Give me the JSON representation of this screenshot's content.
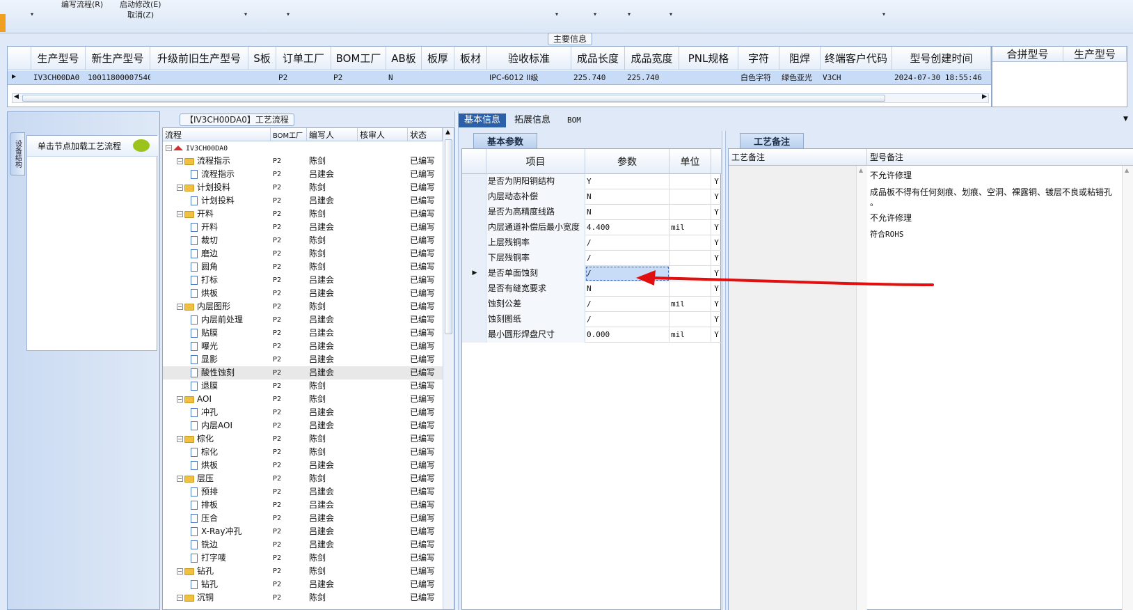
{
  "toolbar": {
    "items": [
      "编写流程(R)",
      "启动修改(E)",
      "取消(Z)"
    ]
  },
  "main_info": {
    "section_title": "主要信息",
    "columns": [
      "生产型号",
      "新生产型号",
      "升级前旧生产型号",
      "S板",
      "订单工厂",
      "BOM工厂",
      "AB板",
      "板厚",
      "板材",
      "验收标准",
      "成品长度",
      "成品宽度",
      "PNL规格",
      "字符",
      "阻焊",
      "终端客户代码",
      "型号创建时间"
    ],
    "row": [
      "IV3CH00DA0",
      "10011800007540",
      "",
      "",
      "P2",
      "P2",
      "N",
      "",
      "",
      "IPC-6012 II级",
      "225.740",
      "225.740",
      "",
      "白色字符",
      "绿色亚光",
      "V3CH",
      "2024-07-30 18:55:46"
    ],
    "merge_columns": [
      "合拼型号",
      "生产型号"
    ]
  },
  "nav": {
    "vertical_tab": "设备结构",
    "card_title": "单击节点加载工艺流程"
  },
  "tree": {
    "section_title": "【IV3CH00DA0】工艺流程",
    "columns": [
      "流程",
      "BOM工厂",
      "编写人",
      "核审人",
      "状态"
    ],
    "root": "IV3CH00DA0",
    "rows": [
      {
        "label": "流程指示",
        "level": 1,
        "bom": "P2",
        "author": "陈剑",
        "status": "已编写"
      },
      {
        "label": "流程指示",
        "level": 2,
        "bom": "P2",
        "author": "吕建会",
        "status": "已编写"
      },
      {
        "label": "计划投料",
        "level": 1,
        "bom": "P2",
        "author": "陈剑",
        "status": "已编写"
      },
      {
        "label": "计划投料",
        "level": 2,
        "bom": "P2",
        "author": "吕建会",
        "status": "已编写"
      },
      {
        "label": "开料",
        "level": 1,
        "bom": "P2",
        "author": "陈剑",
        "status": "已编写"
      },
      {
        "label": "开料",
        "level": 2,
        "bom": "P2",
        "author": "吕建会",
        "status": "已编写"
      },
      {
        "label": "裁切",
        "level": 2,
        "bom": "P2",
        "author": "陈剑",
        "status": "已编写"
      },
      {
        "label": "磨边",
        "level": 2,
        "bom": "P2",
        "author": "陈剑",
        "status": "已编写"
      },
      {
        "label": "圆角",
        "level": 2,
        "bom": "P2",
        "author": "陈剑",
        "status": "已编写"
      },
      {
        "label": "打标",
        "level": 2,
        "bom": "P2",
        "author": "吕建会",
        "status": "已编写"
      },
      {
        "label": "烘板",
        "level": 2,
        "bom": "P2",
        "author": "吕建会",
        "status": "已编写"
      },
      {
        "label": "内层图形",
        "level": 1,
        "bom": "P2",
        "author": "陈剑",
        "status": "已编写"
      },
      {
        "label": "内层前处理",
        "level": 2,
        "bom": "P2",
        "author": "吕建会",
        "status": "已编写"
      },
      {
        "label": "贴膜",
        "level": 2,
        "bom": "P2",
        "author": "吕建会",
        "status": "已编写"
      },
      {
        "label": "曝光",
        "level": 2,
        "bom": "P2",
        "author": "吕建会",
        "status": "已编写"
      },
      {
        "label": "显影",
        "level": 2,
        "bom": "P2",
        "author": "吕建会",
        "status": "已编写"
      },
      {
        "label": "酸性蚀刻",
        "level": 2,
        "bom": "P2",
        "author": "吕建会",
        "status": "已编写",
        "selected": true
      },
      {
        "label": "退膜",
        "level": 2,
        "bom": "P2",
        "author": "陈剑",
        "status": "已编写"
      },
      {
        "label": "AOI",
        "level": 1,
        "bom": "P2",
        "author": "陈剑",
        "status": "已编写"
      },
      {
        "label": "冲孔",
        "level": 2,
        "bom": "P2",
        "author": "吕建会",
        "status": "已编写"
      },
      {
        "label": "内层AOI",
        "level": 2,
        "bom": "P2",
        "author": "吕建会",
        "status": "已编写"
      },
      {
        "label": "棕化",
        "level": 1,
        "bom": "P2",
        "author": "陈剑",
        "status": "已编写"
      },
      {
        "label": "棕化",
        "level": 2,
        "bom": "P2",
        "author": "陈剑",
        "status": "已编写"
      },
      {
        "label": "烘板",
        "level": 2,
        "bom": "P2",
        "author": "吕建会",
        "status": "已编写"
      },
      {
        "label": "层压",
        "level": 1,
        "bom": "P2",
        "author": "陈剑",
        "status": "已编写"
      },
      {
        "label": "预排",
        "level": 2,
        "bom": "P2",
        "author": "吕建会",
        "status": "已编写"
      },
      {
        "label": "排板",
        "level": 2,
        "bom": "P2",
        "author": "吕建会",
        "status": "已编写"
      },
      {
        "label": "压合",
        "level": 2,
        "bom": "P2",
        "author": "吕建会",
        "status": "已编写"
      },
      {
        "label": "X-Ray冲孔",
        "level": 2,
        "bom": "P2",
        "author": "吕建会",
        "status": "已编写"
      },
      {
        "label": "铣边",
        "level": 2,
        "bom": "P2",
        "author": "吕建会",
        "status": "已编写"
      },
      {
        "label": "打字唛",
        "level": 2,
        "bom": "P2",
        "author": "陈剑",
        "status": "已编写"
      },
      {
        "label": "钻孔",
        "level": 1,
        "bom": "P2",
        "author": "陈剑",
        "status": "已编写"
      },
      {
        "label": "钻孔",
        "level": 2,
        "bom": "P2",
        "author": "吕建会",
        "status": "已编写"
      },
      {
        "label": "沉铜",
        "level": 1,
        "bom": "P2",
        "author": "陈剑",
        "status": "已编写"
      }
    ]
  },
  "tabs": [
    "基本信息",
    "拓展信息",
    "BOM"
  ],
  "params": {
    "subtab": "基本参数",
    "columns": [
      "项目",
      "参数",
      "单位"
    ],
    "rows": [
      {
        "item": "是否为阴阳铜结构",
        "value": "Y",
        "unit": "",
        "flag": "Y"
      },
      {
        "item": "内层动态补偿",
        "value": "N",
        "unit": "",
        "flag": "Y"
      },
      {
        "item": "是否为高精度线路",
        "value": "N",
        "unit": "",
        "flag": "Y"
      },
      {
        "item": "内层通道补偿后最小宽度",
        "value": "4.400",
        "unit": "mil",
        "flag": "Y"
      },
      {
        "item": "上层残铜率",
        "value": "/",
        "unit": "",
        "flag": "Y"
      },
      {
        "item": "下层残铜率",
        "value": "/",
        "unit": "",
        "flag": "Y"
      },
      {
        "item": "是否单面蚀刻",
        "value": "/",
        "unit": "",
        "flag": "Y",
        "selected": true
      },
      {
        "item": "是否有缝宽要求",
        "value": "N",
        "unit": "",
        "flag": "Y"
      },
      {
        "item": "蚀刻公差",
        "value": "/",
        "unit": "mil",
        "flag": "Y"
      },
      {
        "item": "蚀刻图纸",
        "value": "/",
        "unit": "",
        "flag": "Y"
      },
      {
        "item": "最小圆形焊盘尺寸",
        "value": "0.000",
        "unit": "mil",
        "flag": "Y"
      }
    ]
  },
  "remarks": {
    "subtab": "工艺备注",
    "columns": [
      "工艺备注",
      "型号备注"
    ],
    "lines": [
      "不允许修理",
      "成品板不得有任何刻痕、划痕、空洞、裸露铜、镀层不良或粘错孔",
      "。",
      "不允许修理",
      "符合ROHS"
    ]
  },
  "colors": {
    "accent": "#2b5fa8",
    "row_highlight": "#c9dcf7",
    "arrow": "#e01010"
  }
}
